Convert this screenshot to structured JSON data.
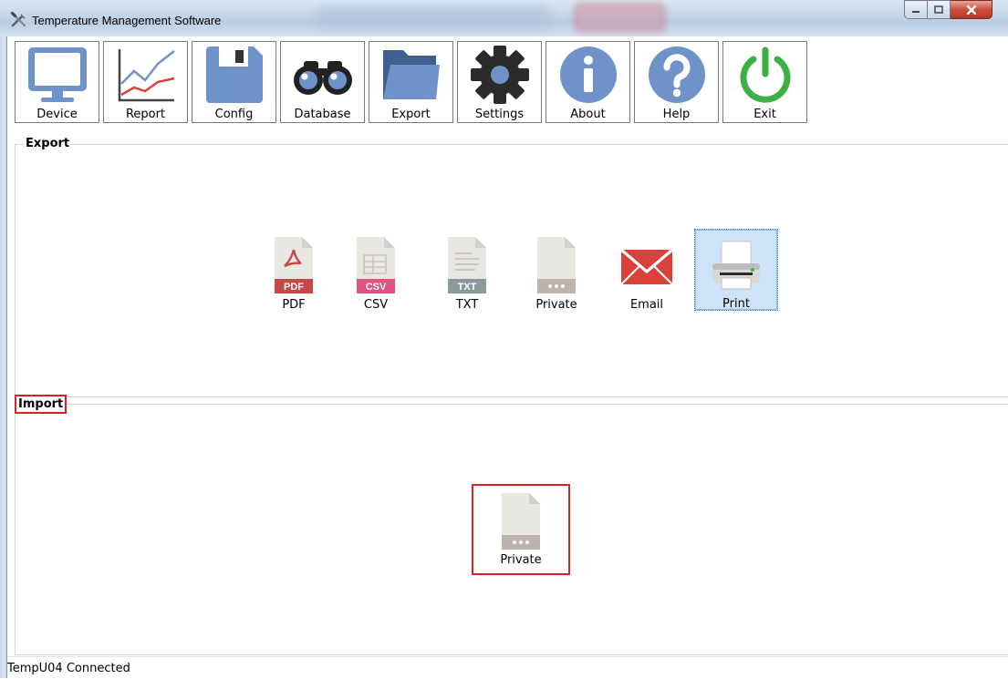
{
  "window": {
    "title": "Temperature Management Software"
  },
  "toolbar": {
    "items": [
      {
        "label": "Device"
      },
      {
        "label": "Report"
      },
      {
        "label": "Config"
      },
      {
        "label": "Database"
      },
      {
        "label": "Export"
      },
      {
        "label": "Settings"
      },
      {
        "label": "About"
      },
      {
        "label": "Help"
      },
      {
        "label": "Exit"
      }
    ]
  },
  "export_group": {
    "title": "Export",
    "items": [
      {
        "label": "PDF",
        "badge": "PDF",
        "icon": "pdf-file-icon"
      },
      {
        "label": "CSV",
        "badge": "CSV",
        "icon": "csv-file-icon"
      },
      {
        "label": "TXT",
        "badge": "TXT",
        "icon": "txt-file-icon"
      },
      {
        "label": "Private",
        "icon": "private-file-icon"
      },
      {
        "label": "Email",
        "icon": "email-icon"
      },
      {
        "label": "Print",
        "icon": "printer-icon",
        "selected": true
      }
    ]
  },
  "import_group": {
    "title": "Import",
    "items": [
      {
        "label": "Private",
        "icon": "private-file-icon"
      }
    ]
  },
  "status": {
    "text": "TempU04 Connected"
  },
  "colors": {
    "icon_blue": "#6f93c9",
    "pdf_red": "#c8484a",
    "csv_pink": "#e0527f",
    "txt_gray": "#8d9a9b",
    "email_red": "#d9413b",
    "exit_green": "#3cb043",
    "highlight_red": "#d3222a"
  }
}
